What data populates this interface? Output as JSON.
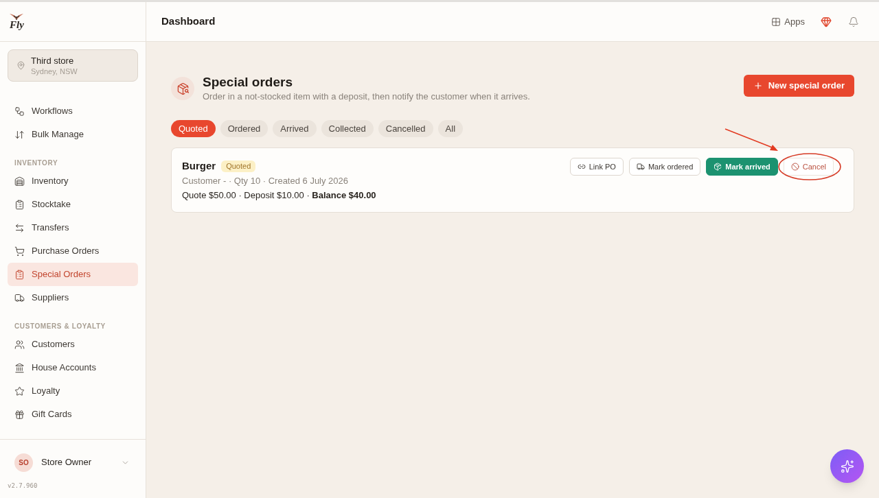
{
  "sidebar": {
    "logo_text": "Fly",
    "store": {
      "name": "Third store",
      "location": "Sydney, NSW"
    },
    "sections": [
      {
        "items": [
          {
            "label": "Workflows",
            "selected": false
          },
          {
            "label": "Bulk Manage",
            "selected": false
          }
        ]
      },
      {
        "title": "INVENTORY",
        "items": [
          {
            "label": "Inventory",
            "selected": false
          },
          {
            "label": "Stocktake",
            "selected": false
          },
          {
            "label": "Transfers",
            "selected": false
          },
          {
            "label": "Purchase Orders",
            "selected": false
          },
          {
            "label": "Special Orders",
            "selected": true
          },
          {
            "label": "Suppliers",
            "selected": false
          }
        ]
      },
      {
        "title": "CUSTOMERS & LOYALTY",
        "items": [
          {
            "label": "Customers",
            "selected": false
          },
          {
            "label": "House Accounts",
            "selected": false
          },
          {
            "label": "Loyalty",
            "selected": false
          },
          {
            "label": "Gift Cards",
            "selected": false
          }
        ]
      }
    ],
    "user": {
      "initials": "SO",
      "name": "Store Owner"
    },
    "version": "v2.7.960"
  },
  "header": {
    "title": "Dashboard",
    "apps_label": "Apps"
  },
  "page": {
    "title": "Special orders",
    "subtitle": "Order in a not-stocked item with a deposit, then notify the customer when it arrives.",
    "new_button": "New special order"
  },
  "filters": [
    {
      "label": "Quoted",
      "selected": true
    },
    {
      "label": "Ordered",
      "selected": false
    },
    {
      "label": "Arrived",
      "selected": false
    },
    {
      "label": "Collected",
      "selected": false
    },
    {
      "label": "Cancelled",
      "selected": false
    },
    {
      "label": "All",
      "selected": false
    }
  ],
  "orders": [
    {
      "name": "Burger",
      "status": "Quoted",
      "details": "Customer - · Qty 10 · Created 6 July 2026",
      "amounts": "Quote $50.00 · Deposit $10.00 · **Balance $40.00**",
      "actions": [
        {
          "label": "Link PO",
          "kind": "outline",
          "highlighted": false
        },
        {
          "label": "Mark ordered",
          "kind": "outline",
          "highlighted": false
        },
        {
          "label": "Mark arrived",
          "kind": "primary",
          "highlighted": false
        },
        {
          "label": "Cancel",
          "kind": "danger",
          "highlighted": true
        }
      ]
    }
  ]
}
